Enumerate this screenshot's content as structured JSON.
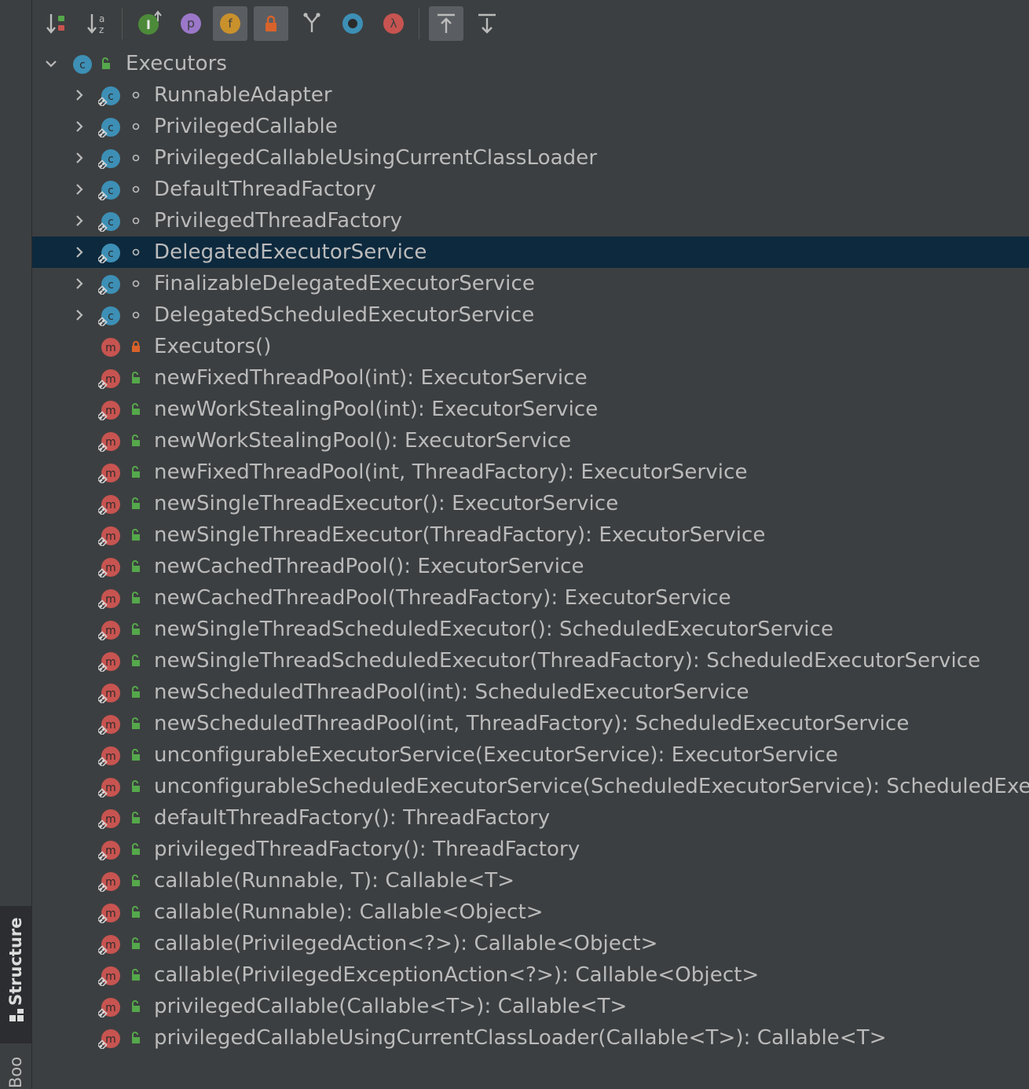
{
  "sidebar": {
    "structure_tab": "Structure",
    "bookmarks_tab": "Bookmarks"
  },
  "colors": {
    "class_icon": "#3d8fb5",
    "method_icon": "#c75450",
    "public_lock": "#55a84b",
    "private_lock": "#d9622b",
    "selection": "#0d293e"
  },
  "toolbar": [
    {
      "name": "sort-by-visibility-icon",
      "active": false
    },
    {
      "name": "sort-alphabetically-icon",
      "active": false
    },
    {
      "name": "show-inherited-icon",
      "active": false
    },
    {
      "name": "show-properties-icon",
      "active": false
    },
    {
      "name": "show-fields-icon",
      "active": true
    },
    {
      "name": "show-non-public-icon",
      "active": true
    },
    {
      "name": "group-icon",
      "active": false
    },
    {
      "name": "show-anonymous-icon",
      "active": false
    },
    {
      "name": "show-lambdas-icon",
      "active": false
    },
    {
      "name": "autoscroll-to-source-icon",
      "active": true
    },
    {
      "name": "autoscroll-from-source-icon",
      "active": false
    }
  ],
  "tree": {
    "root": {
      "label": "Executors",
      "kind": "class",
      "visibility": "public",
      "expanded": true
    },
    "items": [
      {
        "label": "RunnableAdapter",
        "kind": "class-static",
        "visibility": "package",
        "expandable": true
      },
      {
        "label": "PrivilegedCallable",
        "kind": "class-static",
        "visibility": "package",
        "expandable": true
      },
      {
        "label": "PrivilegedCallableUsingCurrentClassLoader",
        "kind": "class-static",
        "visibility": "package",
        "expandable": true
      },
      {
        "label": "DefaultThreadFactory",
        "kind": "class-static",
        "visibility": "package",
        "expandable": true
      },
      {
        "label": "PrivilegedThreadFactory",
        "kind": "class-static",
        "visibility": "package",
        "expandable": true
      },
      {
        "label": "DelegatedExecutorService",
        "kind": "class-static",
        "visibility": "package",
        "expandable": true,
        "selected": true
      },
      {
        "label": "FinalizableDelegatedExecutorService",
        "kind": "class-static",
        "visibility": "package",
        "expandable": true
      },
      {
        "label": "DelegatedScheduledExecutorService",
        "kind": "class-static",
        "visibility": "package",
        "expandable": true
      },
      {
        "label": "Executors()",
        "kind": "method",
        "visibility": "private"
      },
      {
        "label": "newFixedThreadPool(int): ExecutorService",
        "kind": "method-static",
        "visibility": "public"
      },
      {
        "label": "newWorkStealingPool(int): ExecutorService",
        "kind": "method-static",
        "visibility": "public"
      },
      {
        "label": "newWorkStealingPool(): ExecutorService",
        "kind": "method-static",
        "visibility": "public"
      },
      {
        "label": "newFixedThreadPool(int, ThreadFactory): ExecutorService",
        "kind": "method-static",
        "visibility": "public"
      },
      {
        "label": "newSingleThreadExecutor(): ExecutorService",
        "kind": "method-static",
        "visibility": "public"
      },
      {
        "label": "newSingleThreadExecutor(ThreadFactory): ExecutorService",
        "kind": "method-static",
        "visibility": "public"
      },
      {
        "label": "newCachedThreadPool(): ExecutorService",
        "kind": "method-static",
        "visibility": "public"
      },
      {
        "label": "newCachedThreadPool(ThreadFactory): ExecutorService",
        "kind": "method-static",
        "visibility": "public"
      },
      {
        "label": "newSingleThreadScheduledExecutor(): ScheduledExecutorService",
        "kind": "method-static",
        "visibility": "public"
      },
      {
        "label": "newSingleThreadScheduledExecutor(ThreadFactory): ScheduledExecutorService",
        "kind": "method-static",
        "visibility": "public"
      },
      {
        "label": "newScheduledThreadPool(int): ScheduledExecutorService",
        "kind": "method-static",
        "visibility": "public"
      },
      {
        "label": "newScheduledThreadPool(int, ThreadFactory): ScheduledExecutorService",
        "kind": "method-static",
        "visibility": "public"
      },
      {
        "label": "unconfigurableExecutorService(ExecutorService): ExecutorService",
        "kind": "method-static",
        "visibility": "public"
      },
      {
        "label": "unconfigurableScheduledExecutorService(ScheduledExecutorService): ScheduledExecutorService",
        "kind": "method-static",
        "visibility": "public"
      },
      {
        "label": "defaultThreadFactory(): ThreadFactory",
        "kind": "method-static",
        "visibility": "public"
      },
      {
        "label": "privilegedThreadFactory(): ThreadFactory",
        "kind": "method-static",
        "visibility": "public"
      },
      {
        "label": "callable(Runnable, T): Callable<T>",
        "kind": "method-static",
        "visibility": "public"
      },
      {
        "label": "callable(Runnable): Callable<Object>",
        "kind": "method-static",
        "visibility": "public"
      },
      {
        "label": "callable(PrivilegedAction<?>): Callable<Object>",
        "kind": "method-static",
        "visibility": "public"
      },
      {
        "label": "callable(PrivilegedExceptionAction<?>): Callable<Object>",
        "kind": "method-static",
        "visibility": "public"
      },
      {
        "label": "privilegedCallable(Callable<T>): Callable<T>",
        "kind": "method-static",
        "visibility": "public"
      },
      {
        "label": "privilegedCallableUsingCurrentClassLoader(Callable<T>): Callable<T>",
        "kind": "method-static",
        "visibility": "public"
      }
    ]
  }
}
